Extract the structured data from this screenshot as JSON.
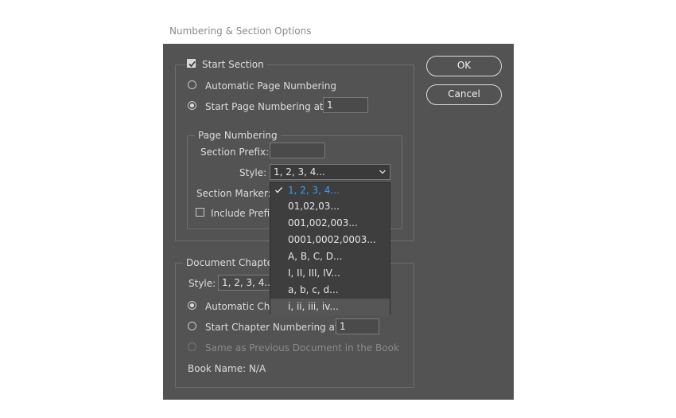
{
  "window": {
    "title": "Numbering & Section Options"
  },
  "section": {
    "start_section_label": "Start Section",
    "start_section_checked": true,
    "auto_numbering_label": "Automatic Page Numbering",
    "start_numbering_label": "Start Page Numbering at:",
    "start_numbering_value": "1",
    "selected_mode": "start_at"
  },
  "page_numbering": {
    "legend": "Page Numbering",
    "section_prefix_label": "Section Prefix:",
    "section_prefix_value": "",
    "style_label": "Style:",
    "style_value": "1, 2, 3, 4...",
    "section_marker_label": "Section Marker:",
    "include_prefix_label": "Include Prefix"
  },
  "style_menu": {
    "items": [
      "1, 2, 3, 4...",
      "01,02,03...",
      "001,002,003...",
      "0001,0002,0003...",
      "A, B, C, D...",
      "I, II, III, IV...",
      "a, b, c, d...",
      "i, ii, iii, iv..."
    ],
    "selected_index": 0,
    "hover_index": 7
  },
  "document_chapter": {
    "legend": "Document Chapter",
    "style_label": "Style:",
    "style_value": "1, 2, 3, 4...",
    "auto_label": "Automatic Cha",
    "start_label": "Start Chapter Numbering at:",
    "start_value": "1",
    "same_as_previous_label": "Same as Previous Document in the Book",
    "book_name_label": "Book Name: N/A"
  },
  "buttons": {
    "ok": "OK",
    "cancel": "Cancel"
  },
  "colors": {
    "dialog_bg": "#535353",
    "accent": "#3b9df5",
    "menu_bg": "#3e3e3e"
  }
}
